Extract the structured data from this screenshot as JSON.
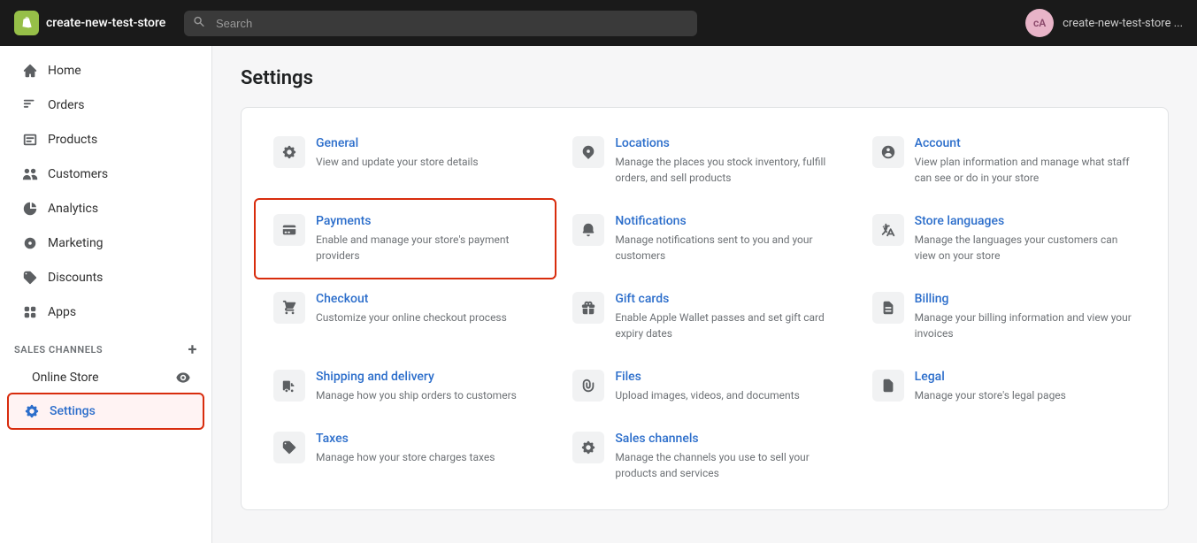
{
  "topbar": {
    "store_name": "create-new-test-store",
    "store_name_right": "create-new-test-store ...",
    "search_placeholder": "Search",
    "avatar_initials": "cA"
  },
  "sidebar": {
    "items": [
      {
        "id": "home",
        "label": "Home",
        "icon": "home"
      },
      {
        "id": "orders",
        "label": "Orders",
        "icon": "orders"
      },
      {
        "id": "products",
        "label": "Products",
        "icon": "products"
      },
      {
        "id": "customers",
        "label": "Customers",
        "icon": "customers"
      },
      {
        "id": "analytics",
        "label": "Analytics",
        "icon": "analytics"
      },
      {
        "id": "marketing",
        "label": "Marketing",
        "icon": "marketing"
      },
      {
        "id": "discounts",
        "label": "Discounts",
        "icon": "discounts"
      },
      {
        "id": "apps",
        "label": "Apps",
        "icon": "apps"
      }
    ],
    "sales_channels_label": "SALES CHANNELS",
    "online_store_label": "Online Store",
    "settings_label": "Settings"
  },
  "page": {
    "title": "Settings",
    "settings_items": [
      {
        "id": "general",
        "title": "General",
        "desc": "View and update your store details",
        "icon": "gear",
        "highlighted": false
      },
      {
        "id": "locations",
        "title": "Locations",
        "desc": "Manage the places you stock inventory, fulfill orders, and sell products",
        "icon": "location",
        "highlighted": false
      },
      {
        "id": "account",
        "title": "Account",
        "desc": "View plan information and manage what staff can see or do in your store",
        "icon": "account",
        "highlighted": false
      },
      {
        "id": "payments",
        "title": "Payments",
        "desc": "Enable and manage your store's payment providers",
        "icon": "payments",
        "highlighted": true
      },
      {
        "id": "notifications",
        "title": "Notifications",
        "desc": "Manage notifications sent to you and your customers",
        "icon": "bell",
        "highlighted": false
      },
      {
        "id": "store-languages",
        "title": "Store languages",
        "desc": "Manage the languages your customers can view on your store",
        "icon": "translate",
        "highlighted": false
      },
      {
        "id": "checkout",
        "title": "Checkout",
        "desc": "Customize your online checkout process",
        "icon": "cart",
        "highlighted": false
      },
      {
        "id": "gift-cards",
        "title": "Gift cards",
        "desc": "Enable Apple Wallet passes and set gift card expiry dates",
        "icon": "gift",
        "highlighted": false
      },
      {
        "id": "billing",
        "title": "Billing",
        "desc": "Manage your billing information and view your invoices",
        "icon": "billing",
        "highlighted": false
      },
      {
        "id": "shipping",
        "title": "Shipping and delivery",
        "desc": "Manage how you ship orders to customers",
        "icon": "truck",
        "highlighted": false
      },
      {
        "id": "files",
        "title": "Files",
        "desc": "Upload images, videos, and documents",
        "icon": "files",
        "highlighted": false
      },
      {
        "id": "legal",
        "title": "Legal",
        "desc": "Manage your store's legal pages",
        "icon": "legal",
        "highlighted": false
      },
      {
        "id": "taxes",
        "title": "Taxes",
        "desc": "Manage how your store charges taxes",
        "icon": "taxes",
        "highlighted": false
      },
      {
        "id": "sales-channels",
        "title": "Sales channels",
        "desc": "Manage the channels you use to sell your products and services",
        "icon": "channels",
        "highlighted": false
      }
    ]
  }
}
